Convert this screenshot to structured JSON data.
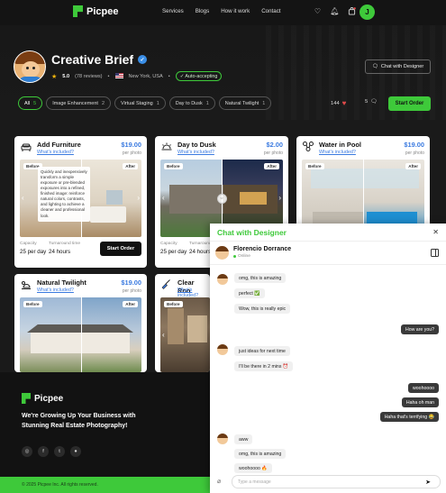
{
  "brand": {
    "name": "Picpee",
    "accent": "#3ec93a"
  },
  "nav": {
    "links": [
      "Services",
      "Blogs",
      "How it work",
      "Contact"
    ],
    "avatar_initial": "J",
    "icons": [
      "heart-icon",
      "bell-icon",
      "cart-icon"
    ]
  },
  "profile": {
    "title": "Creative Brief",
    "rating": "5.0",
    "reviews": "(78 reviews)",
    "location": "New York, USA",
    "auto_badge": "✓ Auto-accepting",
    "chat_button": "Chat with Designer"
  },
  "filters": {
    "chips": [
      {
        "label": "All",
        "count": "5"
      },
      {
        "label": "Image Enhancement",
        "count": "2"
      },
      {
        "label": "Virtual Staging",
        "count": "1"
      },
      {
        "label": "Day to Dusk",
        "count": "1"
      },
      {
        "label": "Natural Twilight",
        "count": "1"
      }
    ],
    "favorites_count": "144",
    "messages_count": "5",
    "start_order": "Start Order"
  },
  "cards": [
    {
      "title": "Add Furniture",
      "link": "What's included?",
      "price": "$19.00",
      "unit": "per photo",
      "before": "Before",
      "after": "After",
      "tooltip": "Quickly and inexpensively transform a simple exposure or pre-blended exposures into a refined, finished image: reinforce natural colors, contrasts, and lighting to achieve a cleaner and professional look.",
      "capacity_label": "Capacity",
      "capacity": "25 per day",
      "turnaround_label": "Turnaround time",
      "turnaround": "24 hours",
      "order": "Start Order"
    },
    {
      "title": "Day to Dusk",
      "link": "What's included?",
      "price": "$2.00",
      "unit": "per photo",
      "before": "Before",
      "after": "After",
      "capacity_label": "Capacity",
      "capacity": "25 per day",
      "turnaround_label": "Turnaround time",
      "turnaround": "24 hours"
    },
    {
      "title": "Water in Pool",
      "link": "What's included?",
      "price": "$19.00",
      "unit": "per photo",
      "before": "Before",
      "after": "After"
    },
    {
      "title": "Natural Twilight",
      "link": "What's included?",
      "price": "$19.00",
      "unit": "per photo",
      "before": "Before",
      "after": "After"
    },
    {
      "title": "Clear Roo",
      "link": "What's included?"
    }
  ],
  "footer": {
    "name": "Picpee",
    "tagline": "We're Growing Up Your Business with Stunning Real Estate Photography!",
    "copyright": "© 2025 Picpee Inc. All rights reserved."
  },
  "chat": {
    "title": "Chat with Designer",
    "peer_name": "Florencio Dorrance",
    "peer_status": "Online",
    "messages": [
      {
        "text": "omg, this is amazing"
      },
      {
        "text": "perfect ✅"
      },
      {
        "text": "Wow, this is really epic"
      },
      {
        "text": "How are you?"
      },
      {
        "text": "just ideas for next time"
      },
      {
        "text": "I'll be there in 2 mins ⏰"
      },
      {
        "text": "woohoooo"
      },
      {
        "text": "Haha oh man"
      },
      {
        "text": "Haha that's terrifying 😂"
      },
      {
        "text": "aww"
      },
      {
        "text": "omg, this is amazing"
      },
      {
        "text": "woohoooo 🔥"
      }
    ],
    "input_placeholder": "Type a message"
  }
}
